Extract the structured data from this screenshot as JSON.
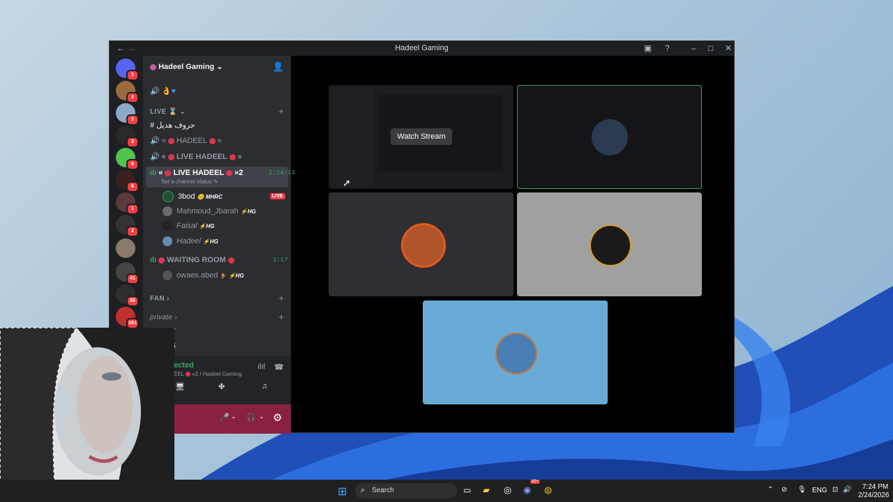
{
  "window": {
    "title": "Hadeel Gaming"
  },
  "server": {
    "name": "Hadeel Gaming"
  },
  "guild_badges": [
    "1",
    "2",
    "5",
    "3",
    "6",
    "6",
    "1",
    "2",
    "",
    "41",
    "58",
    "161"
  ],
  "categories": {
    "live": "LIVE",
    "fan": "FAN",
    "private": "private"
  },
  "channels": {
    "text_arabic": "حروف هديل",
    "ch1": "HADEEL",
    "ch2": "LIVE HADEEL",
    "active": {
      "name": "LIVE HADEEL",
      "suffix": "»2",
      "time": "1:24:13",
      "status": "Set a channel status"
    },
    "waiting": {
      "name": "WAITING ROOM",
      "time": "1:17"
    }
  },
  "voice_users": [
    {
      "name": "3bod",
      "tag": "MHRC",
      "live": "LIVE"
    },
    {
      "name": "Mahmoud_Jbarah",
      "tag": "HG"
    },
    {
      "name": "Faisal",
      "tag": "HG"
    },
    {
      "name": "Hadeel",
      "tag": "HG"
    }
  ],
  "waiting_user": {
    "name": "owaes.abed",
    "tag": "HG"
  },
  "panel": {
    "partial1": "T",
    "partial2": "S",
    "connected": "ected",
    "location": "EEL",
    "server": "»2 / Hadeel Gaming"
  },
  "stream": {
    "watch_label": "Watch Stream"
  },
  "taskbar": {
    "search": "Search",
    "lang": "ENG",
    "time": "7:24 PM",
    "date": "2/24/2026",
    "discord_badge": "99+"
  },
  "colors": {
    "accent_green": "#3ba55d",
    "live_red": "#f23f43",
    "tile_blue": "#6aaad6",
    "tile_grey": "#a0a0a0",
    "tile_dark": "#2f2f33"
  }
}
